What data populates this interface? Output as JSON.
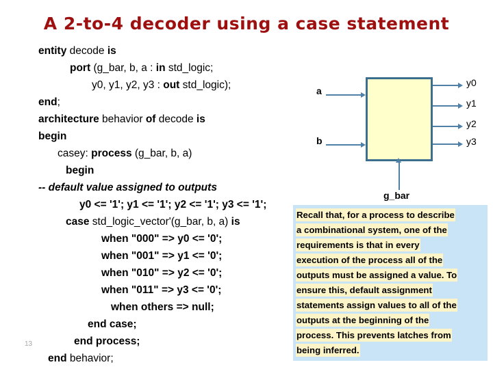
{
  "slide": {
    "title": "A 2-to-4 decoder using a case statement",
    "number": "13",
    "title_color": "#9e1010"
  },
  "code": {
    "lines": [
      {
        "indent": "c-left",
        "parts": [
          {
            "t": "entity ",
            "b": true
          },
          {
            "t": "decode ",
            "b": false
          },
          {
            "t": "is",
            "b": true
          }
        ]
      },
      {
        "indent": "c-i1",
        "parts": [
          {
            "t": "port ",
            "b": true
          },
          {
            "t": "(g_bar, b, a : ",
            "b": false
          },
          {
            "t": "in ",
            "b": true
          },
          {
            "t": "std_logic;",
            "b": false
          }
        ]
      },
      {
        "indent": "c-i2",
        "parts": [
          {
            "t": "y0, y1, y2, y3 : ",
            "b": false
          },
          {
            "t": "out ",
            "b": true
          },
          {
            "t": "std_logic);",
            "b": false
          }
        ]
      },
      {
        "indent": "c-left",
        "parts": [
          {
            "t": "end",
            "b": true
          },
          {
            "t": ";",
            "b": false
          }
        ]
      },
      {
        "indent": "c-left",
        "parts": [
          {
            "t": "architecture ",
            "b": true
          },
          {
            "t": "behavior ",
            "b": false
          },
          {
            "t": "of ",
            "b": true
          },
          {
            "t": "decode ",
            "b": false
          },
          {
            "t": "is",
            "b": true
          }
        ]
      },
      {
        "indent": "c-left",
        "parts": [
          {
            "t": "begin",
            "b": true
          }
        ]
      },
      {
        "indent": "c-i3",
        "parts": [
          {
            "t": "casey: ",
            "b": false
          },
          {
            "t": "process ",
            "b": true
          },
          {
            "t": "(g_bar, b, a)",
            "b": false
          }
        ]
      },
      {
        "indent": "c-i4",
        "parts": [
          {
            "t": "begin",
            "b": true
          }
        ]
      },
      {
        "indent": "c-left",
        "parts": [
          {
            "t": "-- default value assigned to outputs",
            "b": false,
            "i": true
          }
        ]
      },
      {
        "indent": "c-i5",
        "parts": [
          {
            "t": "y0 <= '1'; y1 <= '1'; y2 <= '1'; y3 <= '1';",
            "b": true
          }
        ]
      },
      {
        "indent": "c-i4",
        "parts": [
          {
            "t": "case ",
            "b": true
          },
          {
            "t": "std_logic_vector'(g_bar, b, a) ",
            "b": false
          },
          {
            "t": "is",
            "b": true
          }
        ]
      },
      {
        "indent": "c-i6",
        "parts": [
          {
            "t": "when \"000\" ",
            "b": true
          },
          {
            "t": "=> y0 <= '0';",
            "b": true
          }
        ]
      },
      {
        "indent": "c-i6",
        "parts": [
          {
            "t": "when \"001\" ",
            "b": true
          },
          {
            "t": "=> y1 <= '0';",
            "b": true
          }
        ]
      },
      {
        "indent": "c-i6",
        "parts": [
          {
            "t": "when \"010\" ",
            "b": true
          },
          {
            "t": "=> y2 <= '0';",
            "b": true
          }
        ]
      },
      {
        "indent": "c-i6",
        "parts": [
          {
            "t": "when \"011\" ",
            "b": true
          },
          {
            "t": "=> y3 <= '0';",
            "b": true
          }
        ]
      },
      {
        "indent": "c-i7",
        "parts": [
          {
            "t": "when others ",
            "b": true
          },
          {
            "t": "=> null;",
            "b": true
          }
        ]
      },
      {
        "indent": "c-i8",
        "parts": [
          {
            "t": "end case;",
            "b": true
          }
        ]
      },
      {
        "indent": "c-i9",
        "parts": [
          {
            "t": "end process;",
            "b": true
          }
        ]
      },
      {
        "indent": "c-i10",
        "parts": [
          {
            "t": "end ",
            "b": true
          },
          {
            "t": "behavior;",
            "b": false
          }
        ]
      }
    ]
  },
  "diagram": {
    "box_fill": "#ffffcc",
    "box_border": "#3b6e8f",
    "wire_color": "#4f81a8",
    "inputs": [
      {
        "label": "a"
      },
      {
        "label": "b"
      }
    ],
    "control": {
      "label": "g_bar"
    },
    "outputs": [
      {
        "label": "y0"
      },
      {
        "label": "y1"
      },
      {
        "label": "y2"
      },
      {
        "label": "y3"
      }
    ]
  },
  "callout": {
    "background": "#c9e4f7",
    "highlight": "#fdf5c8",
    "lines": [
      " Recall that, for a process to describe",
      "a combinational system, one of the",
      "requirements is that in every",
      "execution of the process all of the",
      "outputs must be assigned a value. To",
      "ensure this, default assignment",
      "statements assign values to all of the",
      "outputs at the beginning of the",
      "process. This prevents latches from",
      "being inferred."
    ]
  }
}
